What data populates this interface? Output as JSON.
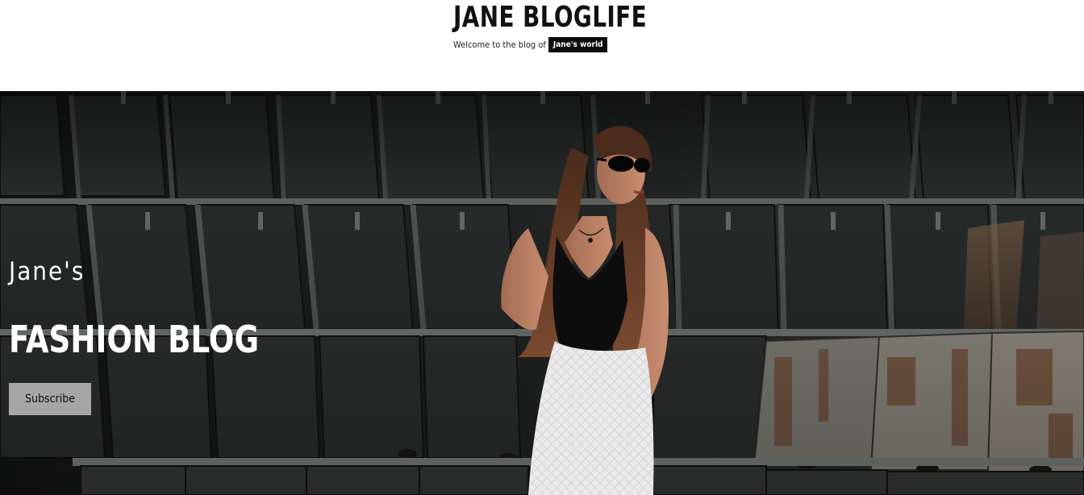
{
  "header": {
    "site_title": "JANE BLOGLIFE",
    "tagline_prefix": "Welcome to the blog of",
    "tagline_highlight": "Jane's world"
  },
  "hero": {
    "kicker": "Jane's",
    "title": "FASHION BLOG",
    "subscribe_label": "Subscribe",
    "image_subject": "woman-in-black-top-and-white-skirt-industrial-background"
  },
  "colors": {
    "page_bg": "#ffffff",
    "title_text": "#111111",
    "tag_bg": "#0c0c0c",
    "button_bg": "#a6a6a6",
    "hero_text": "#ffffff"
  }
}
